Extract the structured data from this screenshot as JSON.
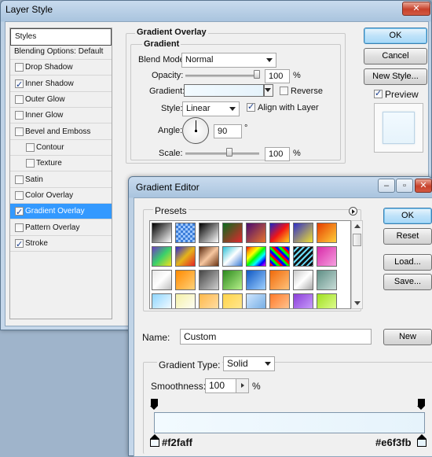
{
  "layer_style": {
    "title": "Layer Style",
    "buttons": {
      "ok": "OK",
      "cancel": "Cancel",
      "new_style": "New Style...",
      "preview": "Preview"
    },
    "styles_list": [
      {
        "label": "Styles",
        "checkbox": false,
        "checked": false
      },
      {
        "label": "Blending Options: Default",
        "checkbox": false,
        "checked": false
      },
      {
        "label": "Drop Shadow",
        "checkbox": true,
        "checked": false
      },
      {
        "label": "Inner Shadow",
        "checkbox": true,
        "checked": true
      },
      {
        "label": "Outer Glow",
        "checkbox": true,
        "checked": false
      },
      {
        "label": "Inner Glow",
        "checkbox": true,
        "checked": false
      },
      {
        "label": "Bevel and Emboss",
        "checkbox": true,
        "checked": false
      },
      {
        "label": "Contour",
        "checkbox": true,
        "checked": false
      },
      {
        "label": "Texture",
        "checkbox": true,
        "checked": false
      },
      {
        "label": "Satin",
        "checkbox": true,
        "checked": false
      },
      {
        "label": "Color Overlay",
        "checkbox": true,
        "checked": false
      },
      {
        "label": "Gradient Overlay",
        "checkbox": true,
        "checked": true
      },
      {
        "label": "Pattern Overlay",
        "checkbox": true,
        "checked": false
      },
      {
        "label": "Stroke",
        "checkbox": true,
        "checked": true
      }
    ],
    "panel": {
      "section_title": "Gradient Overlay",
      "group_title": "Gradient",
      "blend_mode_label": "Blend Mode:",
      "blend_mode_value": "Normal",
      "opacity_label": "Opacity:",
      "opacity_value": "100",
      "percent": "%",
      "gradient_label": "Gradient:",
      "reverse_label": "Reverse",
      "style_label": "Style:",
      "style_value": "Linear",
      "align_label": "Align with Layer",
      "angle_label": "Angle:",
      "angle_value": "90",
      "degree": "°",
      "scale_label": "Scale:",
      "scale_value": "100"
    }
  },
  "gradient_editor": {
    "title": "Gradient Editor",
    "presets_label": "Presets",
    "buttons": {
      "ok": "OK",
      "reset": "Reset",
      "load": "Load...",
      "save": "Save...",
      "new": "New"
    },
    "name_label": "Name:",
    "name_value": "Custom",
    "gradient_type_label": "Gradient Type:",
    "gradient_type_value": "Solid",
    "smoothness_label": "Smoothness:",
    "smoothness_value": "100",
    "percent": "%",
    "stop_left_color": "#f2faff",
    "stop_right_color": "#e6f3fb"
  },
  "colors": {
    "selection": "#3399ff",
    "gradient_start": "#f2faff",
    "gradient_end": "#e6f3fb"
  }
}
